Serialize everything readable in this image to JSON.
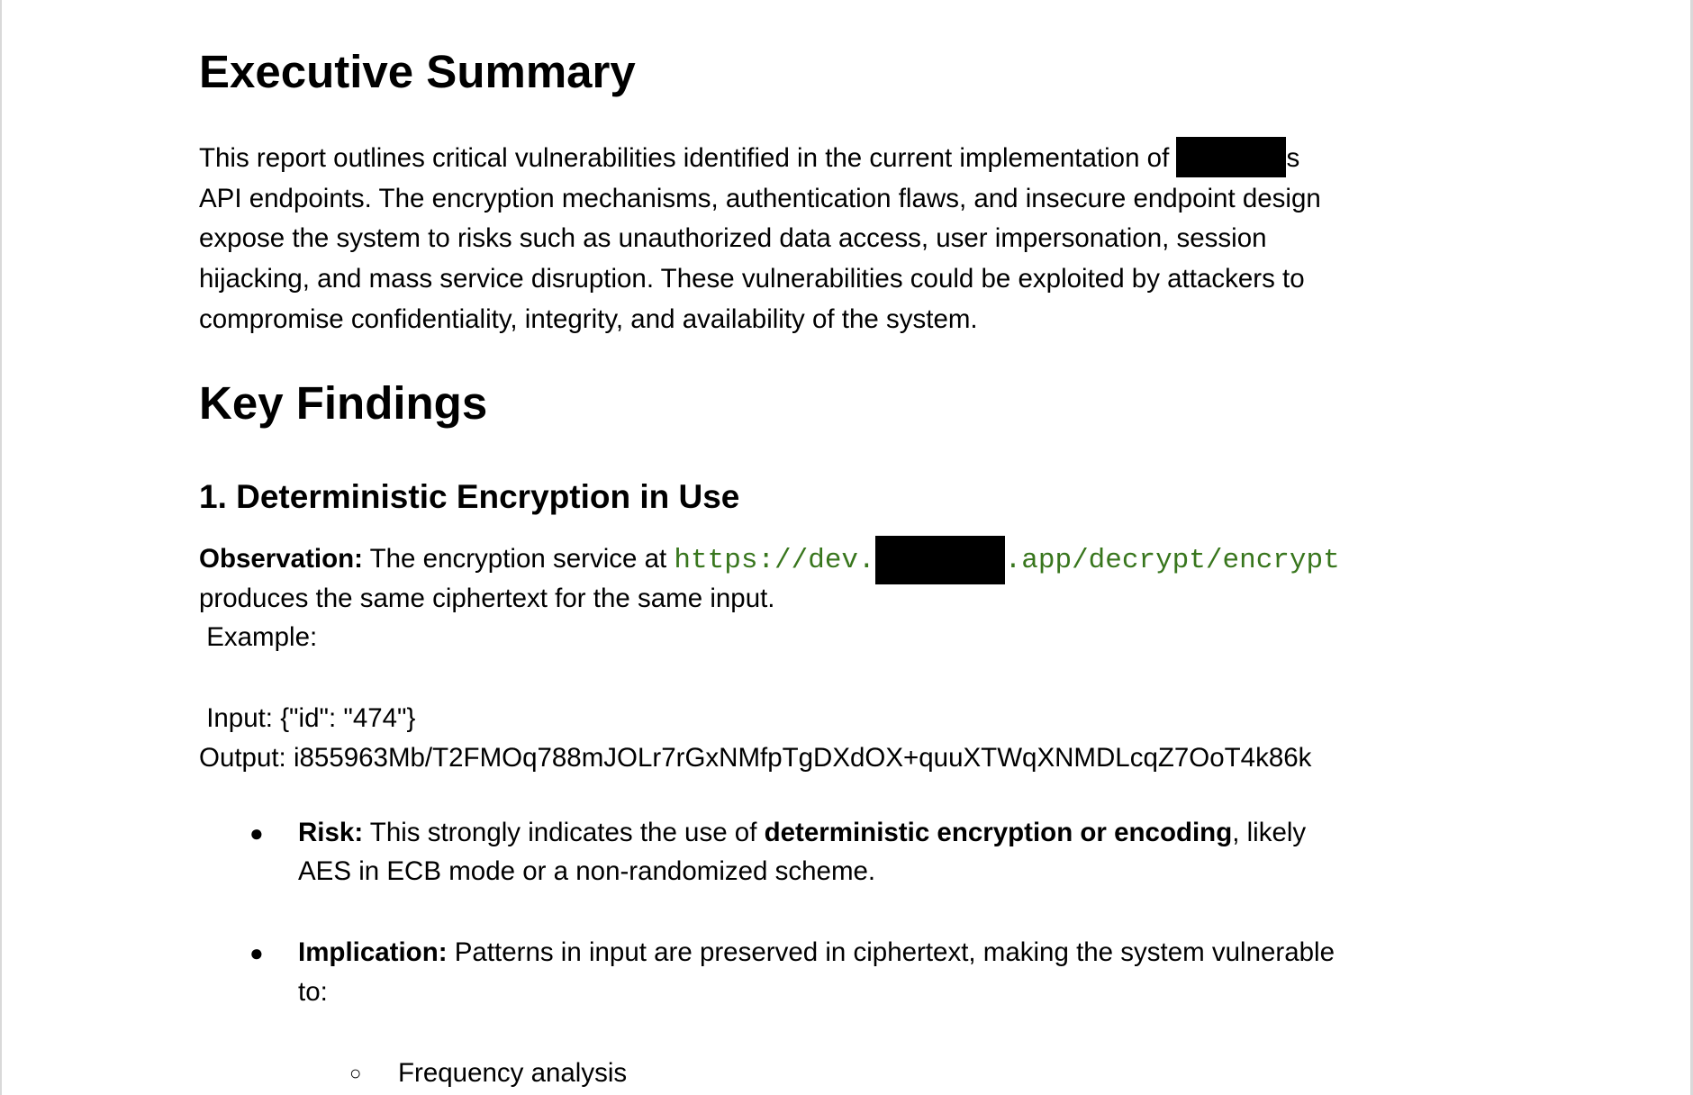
{
  "executive_summary": {
    "heading": "Executive Summary",
    "lines": [
      "This report outlines critical vulnerabilities identified in the current implementation of ",
      "API endpoints. The encryption mechanisms, authentication flaws, and insecure endpoint design",
      "expose the system to risks such as unauthorized data access, user impersonation, session",
      "hijacking, and mass service disruption. These vulnerabilities could be exploited by attackers to",
      "compromise confidentiality, integrity, and availability of the system."
    ],
    "after_redaction": "s"
  },
  "key_findings": {
    "heading": "Key Findings",
    "finding1": {
      "title": "1. Deterministic Encryption in Use",
      "observation_label": "Observation:",
      "observation_text": " The encryption service at ",
      "url_prefix": "https://dev.",
      "url_suffix": ".app/decrypt/encrypt",
      "observation_line2": "produces the same ciphertext for the same input.",
      "example_label": " Example:",
      "input": " Input: {\"id\": \"474\"}",
      "output": "Output: i855963Mb/T2FMOq788mJOLr7rGxNMfpTgDXdOX+quuXTWqXNMDLcqZ7OoT4k86k",
      "risk_label": "Risk:",
      "risk_text1": " This strongly indicates the use of ",
      "risk_bold": "deterministic encryption or encoding",
      "risk_text2": ", likely",
      "risk_line2": "AES in ECB mode or a non-randomized scheme.",
      "implication_label": "Implication:",
      "implication_text": " Patterns in input are preserved in ciphertext, making the system vulnerable",
      "implication_line2": "to:",
      "sub_items": [
        "Frequency analysis"
      ]
    }
  },
  "colors": {
    "code": "#38761d",
    "redaction": "#000000"
  }
}
